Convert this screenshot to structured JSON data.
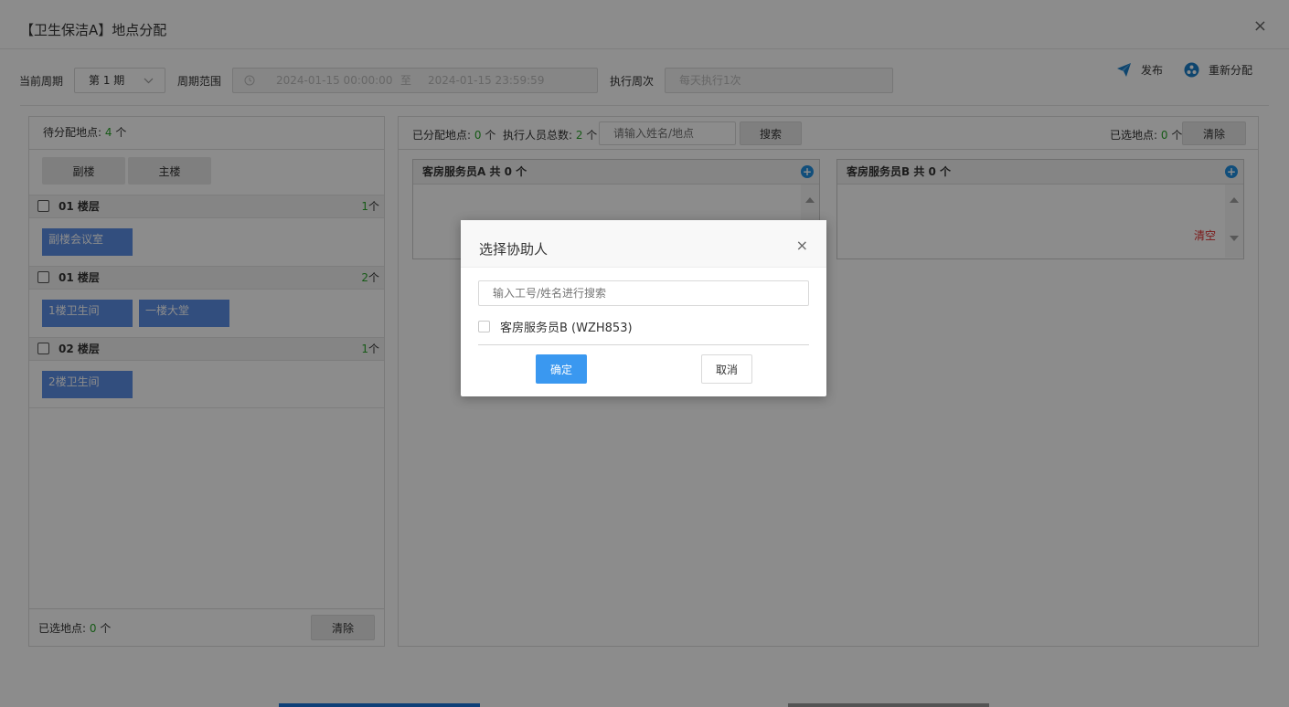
{
  "window": {
    "title": "【卫生保洁A】地点分配",
    "close_glyph": "×"
  },
  "toolbar": {
    "period_label": "当前周期",
    "period_value": "第 1 期",
    "range_label": "周期范围",
    "range_start": "2024-01-15 00:00:00",
    "range_sep": "至",
    "range_end": "2024-01-15 23:59:59",
    "freq_label": "执行周次",
    "freq_value": "每天执行1次",
    "publish_label": "发布",
    "reassign_label": "重新分配"
  },
  "left_panel": {
    "pending_label": "待分配地点: ",
    "pending_count": "4",
    "pending_unit": " 个",
    "tabs": [
      {
        "label": "副楼"
      },
      {
        "label": "主楼"
      }
    ],
    "groups": [
      {
        "name": "01 楼层",
        "count": "1",
        "unit": "个",
        "items": [
          "副楼会议室"
        ]
      },
      {
        "name": "01 楼层",
        "count": "2",
        "unit": "个",
        "items": [
          "1楼卫生间",
          "一楼大堂"
        ]
      },
      {
        "name": "02 楼层",
        "count": "1",
        "unit": "个",
        "items": [
          "2楼卫生间"
        ]
      }
    ],
    "footer_label": "已选地点: ",
    "footer_count": "0",
    "footer_unit": " 个",
    "clear_label": "清除"
  },
  "right_panel": {
    "assigned_label": "已分配地点: ",
    "assigned_count": "0",
    "assigned_unit": " 个",
    "staff_total_label": "执行人员总数: ",
    "staff_total_count": "2",
    "staff_total_unit": " 个",
    "search_placeholder": "请输入姓名/地点",
    "search_button": "搜索",
    "selected_label": "已选地点: ",
    "selected_count": "0",
    "selected_unit": " 个",
    "clear_label": "清除",
    "staff": [
      {
        "title": "客房服务员A  共 0 个"
      },
      {
        "title": "客房服务员B  共 0 个",
        "clear_link": "清空"
      }
    ]
  },
  "dialog": {
    "title": "选择协助人",
    "close_glyph": "×",
    "search_placeholder": "输入工号/姓名进行搜索",
    "options": [
      {
        "label": "客房服务员B (WZH853)",
        "checked": false
      }
    ],
    "ok_label": "确定",
    "cancel_label": "取消"
  },
  "colors": {
    "accent": "#3a98f0",
    "chip": "#5b8ee6",
    "count_green": "#2aa52a",
    "danger": "#e03030"
  },
  "icons": [
    "close-icon",
    "chevron-down-icon",
    "clock-icon",
    "paper-plane-icon",
    "reassign-icon",
    "plus-circle-icon",
    "checkbox-icon"
  ]
}
